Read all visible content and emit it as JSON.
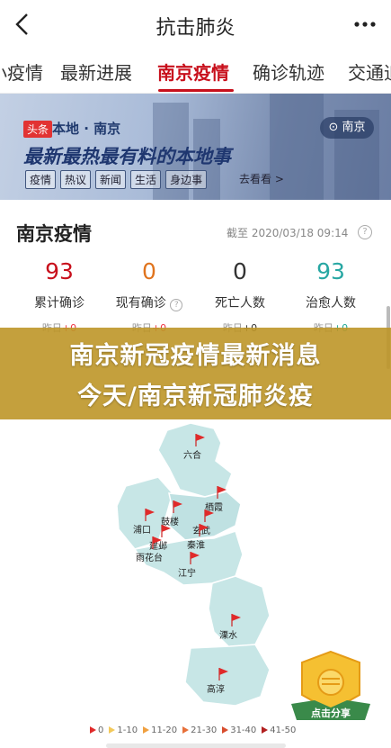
{
  "header": {
    "title": "抗击肺炎"
  },
  "tabs": [
    {
      "label": "小疫情"
    },
    {
      "label": "最新进展"
    },
    {
      "label": "南京疫情"
    },
    {
      "label": "确诊轨迹"
    },
    {
      "label": "交通追"
    }
  ],
  "banner": {
    "badge": "头条",
    "location_tag": "本地 · 南京",
    "headline": "最新最热最有料的本地事",
    "chips": [
      "疫情",
      "热议",
      "新闻",
      "生活",
      "身边事"
    ],
    "more": "去看看 >",
    "pill": "南京"
  },
  "section": {
    "title": "南京疫情",
    "date": "截至 2020/03/18 09:14",
    "help_icon": "?"
  },
  "stats": [
    {
      "value": "93",
      "label": "累计确诊",
      "yest_prefix": "昨日",
      "yest_delta": "+0",
      "color": "#c8101c"
    },
    {
      "value": "0",
      "label": "现有确诊",
      "yest_prefix": "昨日",
      "yest_delta": "+0",
      "color": "#e0741e"
    },
    {
      "value": "0",
      "label": "死亡人数",
      "yest_prefix": "昨日",
      "yest_delta": "+0",
      "color": "#333333"
    },
    {
      "value": "93",
      "label": "治愈人数",
      "yest_prefix": "昨日",
      "yest_delta": "+0",
      "color": "#27a7a3"
    }
  ],
  "overlay": {
    "line1": "南京新冠疫情最新消息",
    "line2": "今天/南京新冠肺炎疫"
  },
  "map": {
    "districts": [
      "六合",
      "浦口",
      "鼓楼",
      "栖霞",
      "建邺",
      "玄武",
      "秦淮",
      "雨花台",
      "江宁",
      "溧水",
      "高淳"
    ]
  },
  "legend": [
    {
      "label": "0",
      "color": "#e02a2a"
    },
    {
      "label": "1-10",
      "color": "#f3c95a"
    },
    {
      "label": "11-20",
      "color": "#f0a040"
    },
    {
      "label": "21-30",
      "color": "#e7703a"
    },
    {
      "label": "31-40",
      "color": "#d84d2e"
    },
    {
      "label": "41-50",
      "color": "#b22020"
    }
  ],
  "share": {
    "label": "点击分享"
  }
}
